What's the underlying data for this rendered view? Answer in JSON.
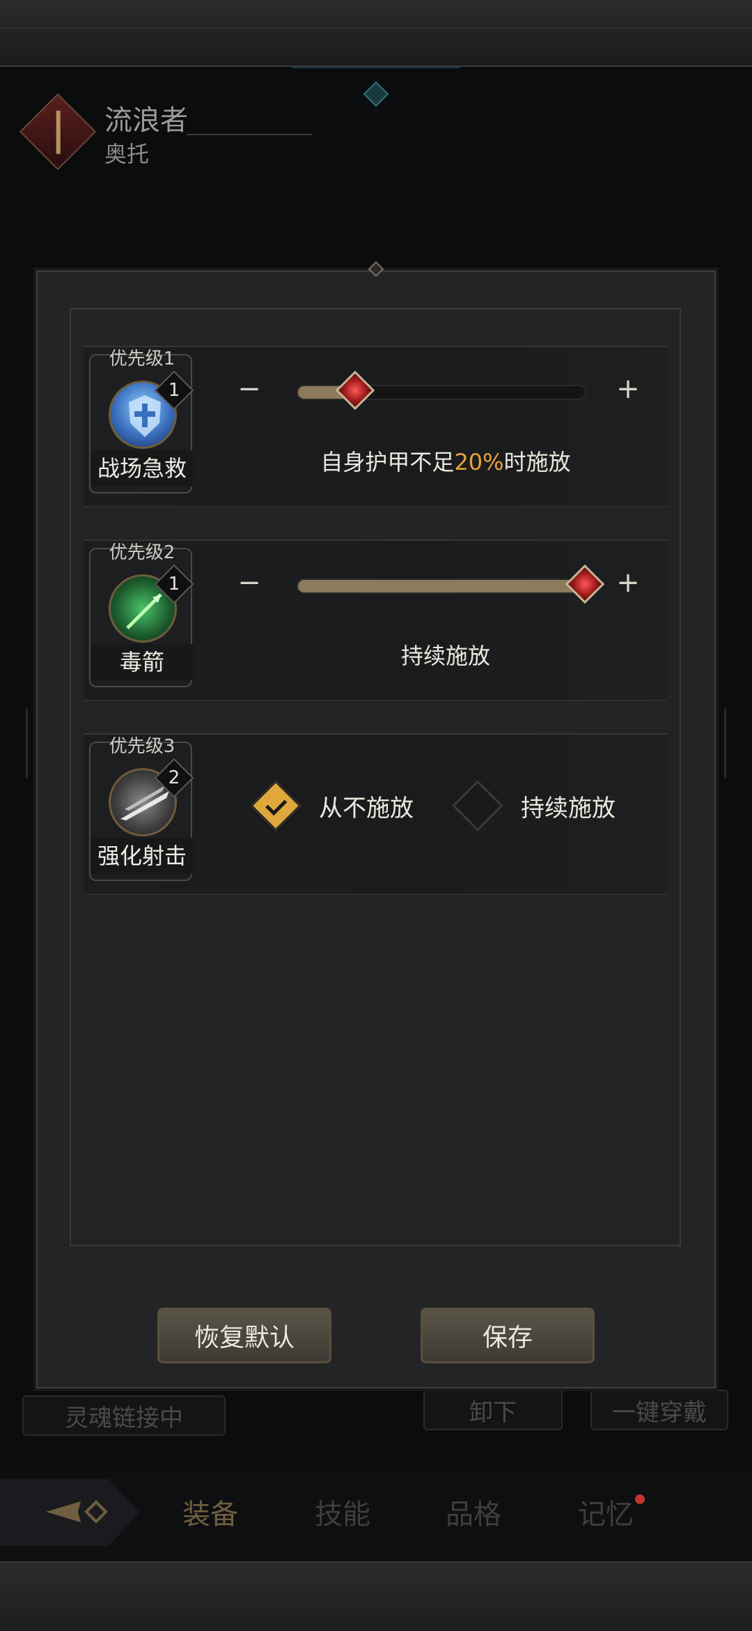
{
  "header": {
    "class_name": "流浪者",
    "hero_name": "奥托"
  },
  "background": {
    "soul_link": "灵魂链接中",
    "unload": "卸下",
    "equip_all": "一键穿戴"
  },
  "nav": {
    "tabs": [
      "装备",
      "技能",
      "品格",
      "记忆"
    ],
    "active_index": 0,
    "notification_on": "记忆"
  },
  "dialog": {
    "skills": [
      {
        "priority": "优先级1",
        "name": "战场急救",
        "level": "1",
        "icon": "shield-heal-icon",
        "control": "slider",
        "slider_fraction": 0.2,
        "desc_prefix": "自身护甲不足",
        "desc_value": "20%",
        "desc_suffix": "时施放"
      },
      {
        "priority": "优先级2",
        "name": "毒箭",
        "level": "1",
        "icon": "poison-arrow-icon",
        "control": "slider",
        "slider_fraction": 1.0,
        "desc": "持续施放"
      },
      {
        "priority": "优先级3",
        "name": "强化射击",
        "level": "2",
        "icon": "power-shot-icon",
        "control": "toggle",
        "options": [
          "从不施放",
          "持续施放"
        ],
        "selected": "从不施放"
      }
    ],
    "buttons": {
      "reset": "恢复默认",
      "save": "保存"
    }
  },
  "colors": {
    "accent": "#e6a33a",
    "knob": "#c62a2a",
    "fill": "#8b7a5c"
  }
}
